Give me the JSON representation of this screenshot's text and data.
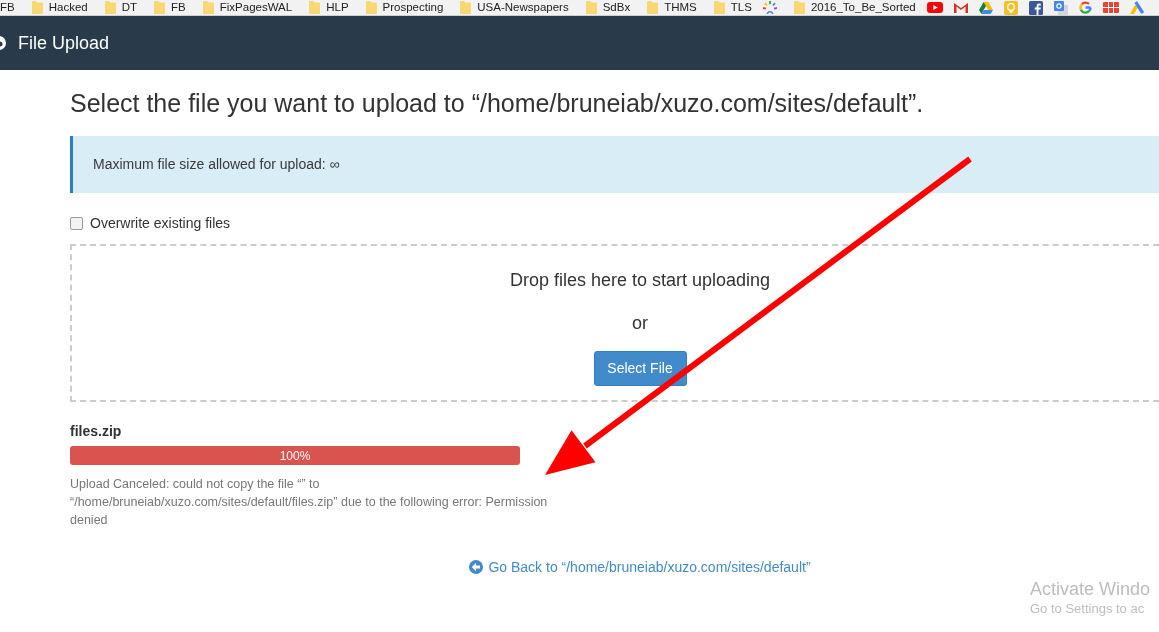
{
  "bookmarks_bar": {
    "items": [
      {
        "kind": "link",
        "label": "FB"
      },
      {
        "kind": "folder",
        "label": "Hacked"
      },
      {
        "kind": "folder",
        "label": "DT"
      },
      {
        "kind": "folder",
        "label": "FB"
      },
      {
        "kind": "folder",
        "label": "FixPagesWAL"
      },
      {
        "kind": "folder",
        "label": "HLP"
      },
      {
        "kind": "folder",
        "label": "Prospecting"
      },
      {
        "kind": "folder",
        "label": "USA-Newspapers"
      },
      {
        "kind": "folder",
        "label": "SdBx"
      },
      {
        "kind": "folder",
        "label": "THMS"
      },
      {
        "kind": "folder",
        "label": "TLS"
      },
      {
        "kind": "icon"
      },
      {
        "kind": "folder",
        "label": "2016_To_Be_Sorted"
      },
      {
        "kind": "icon"
      },
      {
        "kind": "icon"
      },
      {
        "kind": "icon"
      },
      {
        "kind": "icon"
      },
      {
        "kind": "icon"
      },
      {
        "kind": "icon"
      },
      {
        "kind": "icon"
      },
      {
        "kind": "icon"
      },
      {
        "kind": "icon"
      }
    ]
  },
  "header": {
    "title": "File Upload"
  },
  "heading": "Select the file you want to upload to “/home/bruneiab/xuzo.com/sites/default”.",
  "info_alert": {
    "text": "Maximum file size allowed for upload: ∞"
  },
  "overwrite_checkbox": {
    "label": "Overwrite existing files",
    "checked": false
  },
  "dropzone": {
    "prompt": "Drop files here to start uploading",
    "separator": "or",
    "button": "Select File"
  },
  "upload": {
    "file_name": "files.zip",
    "level": 1,
    "progress_text": "100%",
    "message": "Upload Canceled: could not copy the file “” to “/home/bruneiab/xuzo.com/sites/default/files.zip” due to the following error: Permission denied"
  },
  "back_link": "Go Back to “/home/bruneiab/xuzo.com/sites/default”",
  "activation_notice": {
    "title": "Activate Windo",
    "subtitle": "Go to Settings to ac"
  }
}
